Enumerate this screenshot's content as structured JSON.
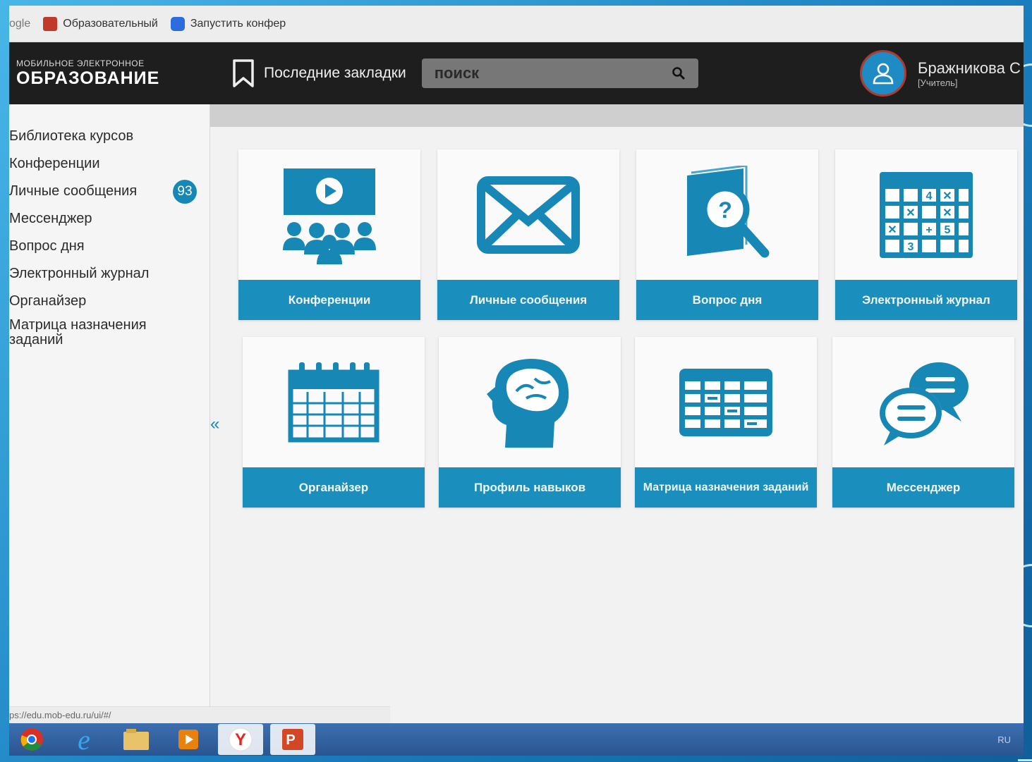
{
  "browser": {
    "bookmarks": [
      {
        "label": "ogle",
        "icon": "google-icon"
      },
      {
        "label": "Образовательный",
        "icon": "red-square-icon"
      },
      {
        "label": "Запустить конфер",
        "icon": "video-call-icon"
      }
    ],
    "status_url": "ps://edu.mob-edu.ru/ui/#/"
  },
  "header": {
    "logo_small": "МОБИЛЬНОЕ ЭЛЕКТРОННОЕ",
    "logo_big": "ОБРАЗОВАНИЕ",
    "bookmarks_label": "Последние закладки",
    "search_placeholder": "поиск",
    "user_name": "Бражникова С",
    "user_role": "[Учитель]"
  },
  "sidebar": {
    "items": [
      {
        "label": "Библиотека курсов"
      },
      {
        "label": "Конференции"
      },
      {
        "label": "Личные сообщения",
        "badge": "93"
      },
      {
        "label": "Мессенджер"
      },
      {
        "label": "Вопрос дня"
      },
      {
        "label": "Электронный журнал"
      },
      {
        "label": "Органайзер"
      },
      {
        "label": "Матрица назначения заданий"
      }
    ],
    "collapse_label": "«"
  },
  "tiles": [
    {
      "label": "Конференции",
      "icon": "conference-icon"
    },
    {
      "label": "Личные сообщения",
      "icon": "envelope-icon"
    },
    {
      "label": "Вопрос дня",
      "icon": "question-book-icon"
    },
    {
      "label": "Электронный журнал",
      "icon": "grade-grid-icon"
    },
    {
      "label": "Органайзер",
      "icon": "calendar-icon"
    },
    {
      "label": "Профиль навыков",
      "icon": "brain-head-icon"
    },
    {
      "label": "Матрица назначения заданий",
      "icon": "matrix-table-icon"
    },
    {
      "label": "Мессенджер",
      "icon": "chat-bubbles-icon"
    }
  ],
  "taskbar": {
    "apps": [
      "chrome",
      "internet-explorer",
      "file-explorer",
      "media-player",
      "yandex-browser",
      "powerpoint"
    ],
    "lang": "RU"
  },
  "colors": {
    "accent": "#1a8ebd",
    "header_bg": "#1e1e1e",
    "badge": "#1787b5"
  }
}
